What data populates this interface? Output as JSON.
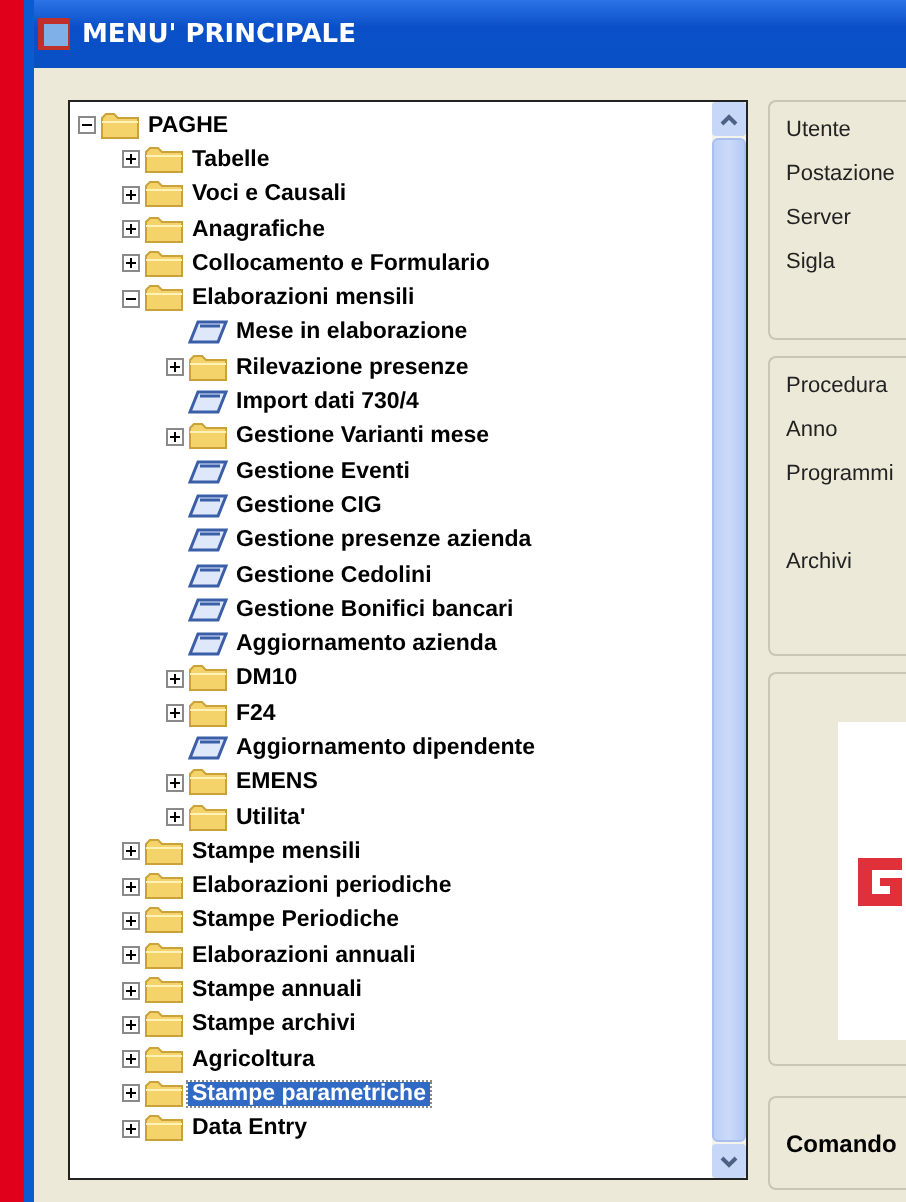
{
  "window": {
    "title": "MENU' PRINCIPALE"
  },
  "tree": [
    {
      "label": "PAGHE",
      "kind": "folder",
      "expanded": true,
      "selected": false,
      "children": [
        {
          "label": "Tabelle",
          "kind": "folder",
          "expanded": false,
          "selected": false
        },
        {
          "label": "Voci e Causali",
          "kind": "folder",
          "expanded": false,
          "selected": false
        },
        {
          "label": "Anagrafiche",
          "kind": "folder",
          "expanded": false,
          "selected": false
        },
        {
          "label": "Collocamento e Formulario",
          "kind": "folder",
          "expanded": false,
          "selected": false
        },
        {
          "label": "Elaborazioni mensili",
          "kind": "folder",
          "expanded": true,
          "selected": false,
          "children": [
            {
              "label": "Mese in elaborazione",
              "kind": "program",
              "selected": false
            },
            {
              "label": "Rilevazione presenze",
              "kind": "folder",
              "expanded": false,
              "selected": false
            },
            {
              "label": "Import dati 730/4",
              "kind": "program",
              "selected": false
            },
            {
              "label": "Gestione Varianti mese",
              "kind": "folder",
              "expanded": false,
              "selected": false
            },
            {
              "label": "Gestione Eventi",
              "kind": "program",
              "selected": false
            },
            {
              "label": "Gestione CIG",
              "kind": "program",
              "selected": false
            },
            {
              "label": "Gestione presenze azienda",
              "kind": "program",
              "selected": false
            },
            {
              "label": "Gestione Cedolini",
              "kind": "program",
              "selected": false
            },
            {
              "label": "Gestione Bonifici bancari",
              "kind": "program",
              "selected": false
            },
            {
              "label": "Aggiornamento azienda",
              "kind": "program",
              "selected": false
            },
            {
              "label": "DM10",
              "kind": "folder",
              "expanded": false,
              "selected": false
            },
            {
              "label": "F24",
              "kind": "folder",
              "expanded": false,
              "selected": false
            },
            {
              "label": "Aggiornamento dipendente",
              "kind": "program",
              "selected": false
            },
            {
              "label": "EMENS",
              "kind": "folder",
              "expanded": false,
              "selected": false
            },
            {
              "label": "Utilita'",
              "kind": "folder",
              "expanded": false,
              "selected": false
            }
          ]
        },
        {
          "label": "Stampe mensili",
          "kind": "folder",
          "expanded": false,
          "selected": false
        },
        {
          "label": "Elaborazioni periodiche",
          "kind": "folder",
          "expanded": false,
          "selected": false
        },
        {
          "label": "Stampe Periodiche",
          "kind": "folder",
          "expanded": false,
          "selected": false
        },
        {
          "label": "Elaborazioni annuali",
          "kind": "folder",
          "expanded": false,
          "selected": false
        },
        {
          "label": "Stampe annuali",
          "kind": "folder",
          "expanded": false,
          "selected": false
        },
        {
          "label": "Stampe archivi",
          "kind": "folder",
          "expanded": false,
          "selected": false
        },
        {
          "label": "Agricoltura",
          "kind": "folder",
          "expanded": false,
          "selected": false
        },
        {
          "label": "Stampe parametriche",
          "kind": "folder",
          "expanded": false,
          "selected": true
        },
        {
          "label": "Data Entry",
          "kind": "folder",
          "expanded": false,
          "selected": false
        }
      ]
    }
  ],
  "session_panel": {
    "labels": [
      "Utente",
      "Postazione",
      "Server",
      "Sigla"
    ]
  },
  "procedure_panel": {
    "labels": [
      {
        "label": "Procedura",
        "spaced": false
      },
      {
        "label": "Anno",
        "spaced": false
      },
      {
        "label": "Programmi",
        "spaced": false
      },
      {
        "label": "Archivi",
        "spaced": true
      }
    ]
  },
  "command_panel": {
    "label": "Comando"
  }
}
